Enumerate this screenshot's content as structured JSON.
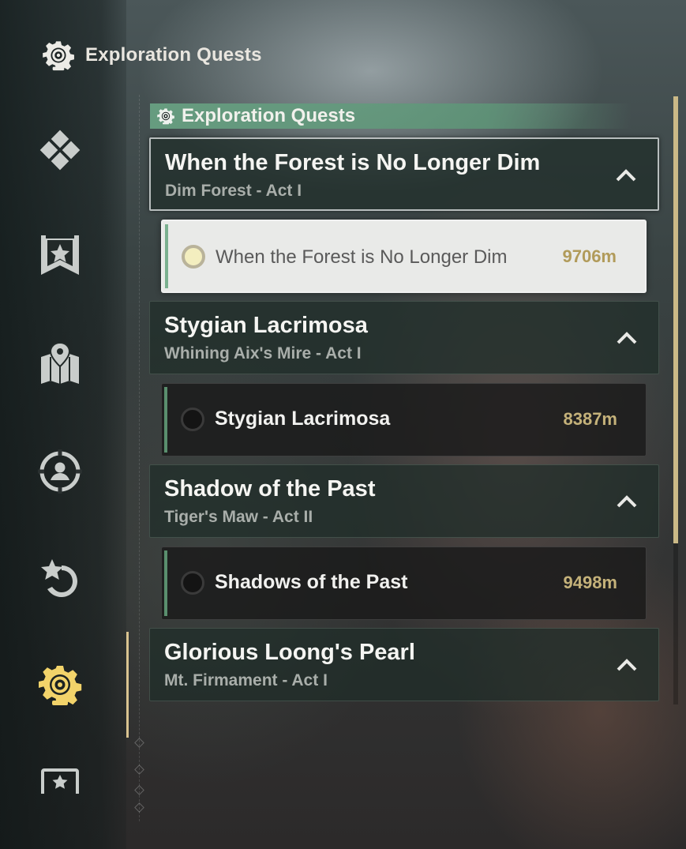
{
  "header": {
    "title": "Exploration Quests",
    "icon": "gear-eye-icon"
  },
  "sidebar": {
    "items": [
      {
        "name": "diamond-cluster-icon",
        "active": false
      },
      {
        "name": "star-banner-icon",
        "active": false
      },
      {
        "name": "map-pin-icon",
        "active": false
      },
      {
        "name": "person-target-icon",
        "active": false
      },
      {
        "name": "star-refresh-icon",
        "active": false
      },
      {
        "name": "gear-eye-icon",
        "active": true
      },
      {
        "name": "star-screen-icon",
        "active": false
      }
    ],
    "active_color": "#f2d36a",
    "icon_color": "#c9cdcb"
  },
  "section": {
    "title": "Exploration Quests",
    "color": "#68a082"
  },
  "quests": [
    {
      "title": "When the Forest is No Longer Dim",
      "subtitle": "Dim Forest - Act I",
      "selected": true,
      "step": {
        "title": "When the Forest is No Longer Dim",
        "distance": "9706m",
        "active": true
      }
    },
    {
      "title": "Stygian Lacrimosa",
      "subtitle": "Whining Aix's Mire - Act I",
      "selected": false,
      "step": {
        "title": "Stygian Lacrimosa",
        "distance": "8387m",
        "active": false
      }
    },
    {
      "title": "Shadow of the Past",
      "subtitle": "Tiger's Maw - Act II",
      "selected": false,
      "step": {
        "title": "Shadows of the Past",
        "distance": "9498m",
        "active": false
      }
    },
    {
      "title": "Glorious Loong's Pearl",
      "subtitle": "Mt. Firmament - Act I",
      "selected": false
    }
  ],
  "colors": {
    "accent_gold": "#cbb987",
    "distance_gold": "#c5b27a"
  }
}
